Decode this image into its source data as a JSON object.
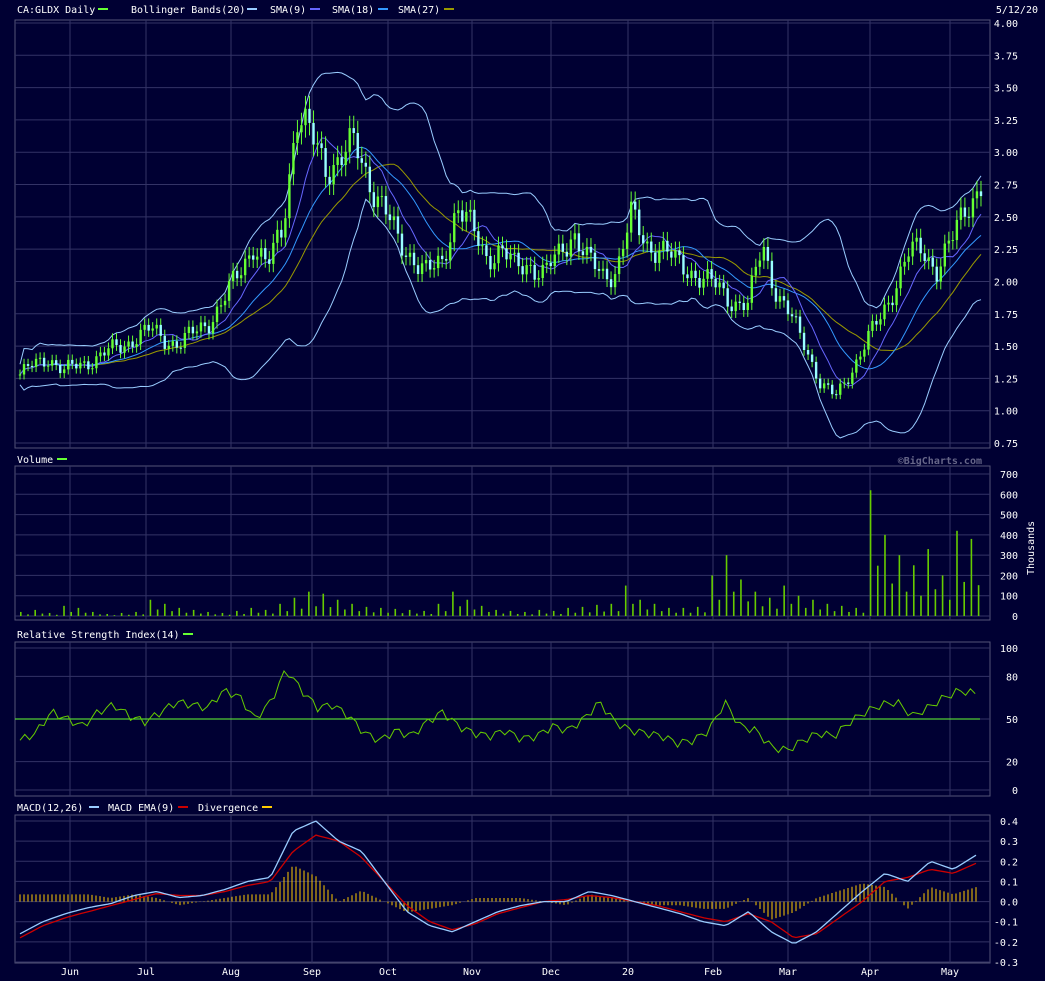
{
  "header": {
    "symbol": "CA:GLDX Daily",
    "date": "5/12/20",
    "legend": [
      {
        "label": "Bollinger Bands(20)",
        "color": "#99ccff"
      },
      {
        "label": "SMA(9)",
        "color": "#6666ff"
      },
      {
        "label": "SMA(18)",
        "color": "#3399ff"
      },
      {
        "label": "SMA(27)",
        "color": "#999900"
      }
    ],
    "symbol_color": "#66ff33"
  },
  "watermark": "©BigCharts.com",
  "months": [
    "Jun",
    "Jul",
    "Aug",
    "Sep",
    "Oct",
    "Nov",
    "Dec",
    "20",
    "Feb",
    "Mar",
    "Apr",
    "May"
  ],
  "chart_data": [
    {
      "type": "candlestick",
      "title": "CA:GLDX Daily",
      "ylim": [
        0.75,
        4.0
      ],
      "yticks": [
        "4.00",
        "3.75",
        "3.50",
        "3.25",
        "3.00",
        "2.75",
        "2.50",
        "2.25",
        "2.00",
        "1.75",
        "1.50",
        "1.25",
        "1.00",
        "0.75"
      ],
      "x_ticks": [
        "Jun",
        "Jul",
        "Aug",
        "Sep",
        "Oct",
        "Nov",
        "Dec",
        "20",
        "Feb",
        "Mar",
        "Apr",
        "May"
      ],
      "close_series_approx": [
        1.28,
        1.35,
        1.42,
        1.3,
        1.35,
        1.4,
        1.45,
        1.5,
        1.58,
        1.62,
        1.55,
        1.52,
        1.6,
        1.7,
        1.85,
        2.05,
        2.3,
        2.1,
        2.4,
        3.3,
        3.1,
        2.9,
        2.95,
        3.05,
        2.8,
        2.55,
        2.3,
        2.2,
        2.05,
        2.15,
        2.6,
        2.4,
        2.2,
        2.25,
        2.1,
        2.15,
        2.05,
        2.2,
        2.4,
        2.15,
        2.05,
        2.1,
        2.5,
        2.3,
        2.25,
        2.15,
        2.1,
        2.0,
        1.95,
        1.85,
        1.8,
        2.3,
        1.9,
        1.7,
        1.5,
        1.2,
        1.1,
        1.3,
        1.5,
        1.7,
        1.95,
        2.2,
        2.25,
        2.1,
        2.3,
        2.6,
        2.75
      ],
      "series": [
        {
          "name": "Bollinger Bands(20)"
        },
        {
          "name": "SMA(9)"
        },
        {
          "name": "SMA(18)"
        },
        {
          "name": "SMA(27)"
        }
      ]
    },
    {
      "type": "bar",
      "title": "Volume",
      "ylabel": "Thousands",
      "ylim": [
        0,
        700
      ],
      "yticks": [
        "700",
        "600",
        "500",
        "400",
        "300",
        "200",
        "100",
        "0"
      ],
      "values_approx": [
        20,
        30,
        15,
        50,
        40,
        20,
        10,
        15,
        20,
        80,
        60,
        40,
        30,
        20,
        15,
        25,
        40,
        30,
        60,
        90,
        120,
        110,
        80,
        60,
        45,
        40,
        35,
        30,
        25,
        60,
        120,
        80,
        50,
        30,
        25,
        20,
        30,
        25,
        40,
        45,
        55,
        60,
        150,
        80,
        60,
        40,
        40,
        45,
        200,
        300,
        180,
        120,
        90,
        150,
        100,
        80,
        60,
        50,
        40,
        620,
        400,
        300,
        250,
        330,
        200,
        420,
        380
      ],
      "spikes": [
        {
          "month": "Apr",
          "value": 620
        },
        {
          "month": "May",
          "value": 440
        }
      ]
    },
    {
      "type": "line",
      "title": "Relative Strength Index(14)",
      "ylim": [
        0,
        100
      ],
      "yticks": [
        "100",
        "80",
        "50",
        "20",
        "0"
      ],
      "reference_line": 50,
      "values_approx": [
        35,
        40,
        55,
        50,
        45,
        55,
        60,
        52,
        48,
        55,
        62,
        60,
        58,
        70,
        66,
        50,
        62,
        85,
        70,
        58,
        60,
        52,
        40,
        35,
        42,
        38,
        48,
        55,
        45,
        40,
        38,
        42,
        36,
        38,
        45,
        42,
        50,
        62,
        48,
        42,
        40,
        38,
        33,
        35,
        42,
        62,
        45,
        42,
        30,
        28,
        35,
        40,
        38,
        48,
        55,
        60,
        62,
        52,
        58,
        65,
        70,
        68
      ],
      "series": [
        {
          "name": "Relative Strength Index(14)",
          "color": "#66cc00"
        }
      ]
    },
    {
      "type": "line",
      "title": "MACD(12,26)",
      "ylim": [
        -0.3,
        0.4
      ],
      "yticks": [
        "0.4",
        "0.3",
        "0.2",
        "0.1",
        "0.0",
        "-0.1",
        "-0.2",
        "-0.3"
      ],
      "series": [
        {
          "name": "MACD(12,26)",
          "color": "#99ccff",
          "values_approx": [
            -0.16,
            -0.1,
            -0.06,
            -0.03,
            -0.01,
            0.03,
            0.05,
            0.02,
            0.03,
            0.06,
            0.1,
            0.12,
            0.35,
            0.4,
            0.3,
            0.25,
            0.1,
            -0.05,
            -0.12,
            -0.15,
            -0.1,
            -0.05,
            -0.02,
            0.0,
            0.0,
            0.05,
            0.03,
            0.0,
            -0.03,
            -0.06,
            -0.1,
            -0.12,
            -0.05,
            -0.15,
            -0.21,
            -0.15,
            -0.05,
            0.05,
            0.14,
            0.1,
            0.2,
            0.16,
            0.23
          ]
        },
        {
          "name": "MACD EMA(9)",
          "color": "#cc0000",
          "values_approx": [
            -0.18,
            -0.12,
            -0.08,
            -0.05,
            -0.02,
            0.01,
            0.04,
            0.03,
            0.03,
            0.05,
            0.08,
            0.1,
            0.25,
            0.33,
            0.3,
            0.22,
            0.1,
            -0.02,
            -0.1,
            -0.14,
            -0.11,
            -0.06,
            -0.03,
            0.0,
            0.01,
            0.03,
            0.02,
            0.0,
            -0.02,
            -0.05,
            -0.08,
            -0.1,
            -0.06,
            -0.1,
            -0.18,
            -0.16,
            -0.08,
            0.0,
            0.1,
            0.12,
            0.16,
            0.14,
            0.19
          ]
        },
        {
          "name": "Divergence",
          "color": "#ffcc00"
        }
      ]
    }
  ]
}
